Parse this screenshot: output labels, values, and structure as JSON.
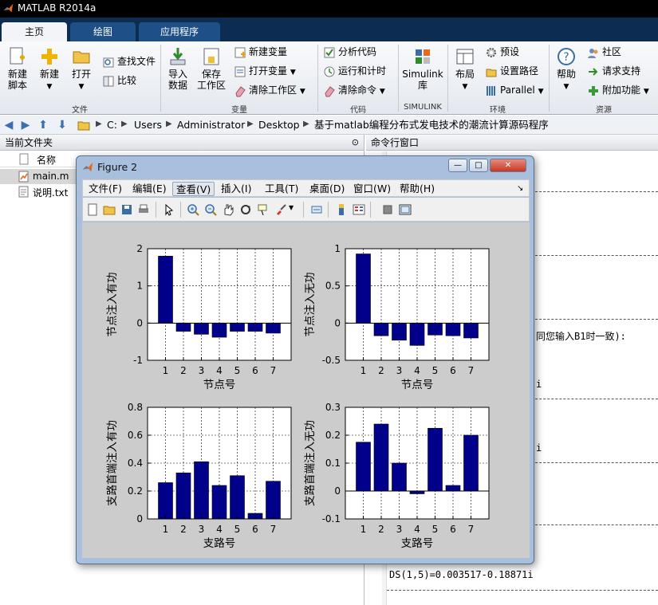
{
  "app": {
    "title": "MATLAB R2014a"
  },
  "tabs": [
    {
      "label": "主页"
    },
    {
      "label": "绘图"
    },
    {
      "label": "应用程序"
    }
  ],
  "ribbon": {
    "file": {
      "group_label": "文件",
      "new_script": "新建\n脚本",
      "new": "新建",
      "open": "打开",
      "find_files": "查找文件",
      "compare": "比较"
    },
    "variable": {
      "group_label": "变量",
      "import": "导入\n数据",
      "save_ws": "保存\n工作区",
      "new_var": "新建变量",
      "open_var": "打开变量",
      "clear_ws": "清除工作区"
    },
    "code": {
      "group_label": "代码",
      "analyze": "分析代码",
      "run_time": "运行和计时",
      "clear_cmd": "清除命令"
    },
    "simulink": {
      "group_label": "SIMULINK",
      "btn": "Simulink\n库"
    },
    "env": {
      "group_label": "环境",
      "layout": "布局",
      "prefs": "预设",
      "set_path": "设置路径",
      "parallel": "Parallel"
    },
    "resources": {
      "group_label": "资源",
      "help": "帮助",
      "community": "社区",
      "support": "请求支持",
      "addons": "附加功能"
    }
  },
  "address": {
    "crumbs": [
      "C:",
      "Users",
      "Administrator",
      "Desktop",
      "基于matlab编程分布式发电技术的潮流计算源码程序"
    ]
  },
  "current_folder": {
    "title": "当前文件夹",
    "column": "名称",
    "files": [
      {
        "name": "main.m"
      },
      {
        "name": "说明.txt"
      }
    ]
  },
  "command_window": {
    "title": "命令行窗口",
    "fragment_1": "同您输入B1时一致):",
    "fragment_2": "i",
    "fragment_3": "i",
    "line_ds": "DS(1,5)=0.003517-0.18871i"
  },
  "figure": {
    "title": "Figure 2",
    "menu": [
      "文件(F)",
      "编辑(E)",
      "查看(V)",
      "插入(I)",
      "工具(T)",
      "桌面(D)",
      "窗口(W)",
      "帮助(H)"
    ],
    "toolbar_icons": [
      "new-figure-icon",
      "open-file-icon",
      "save-icon",
      "print-icon",
      "pointer-icon",
      "zoom-in-icon",
      "zoom-out-icon",
      "pan-icon",
      "rotate-icon",
      "data-cursor-icon",
      "brush-icon",
      "link-icon",
      "colorbar-icon",
      "legend-icon",
      "hide-plot-tools-icon",
      "show-plot-tools-icon"
    ],
    "bar_color": "#00008b"
  },
  "chart_data": [
    {
      "type": "bar",
      "categories": [
        "1",
        "2",
        "3",
        "4",
        "5",
        "6",
        "7"
      ],
      "values": [
        1.8,
        -0.22,
        -0.3,
        -0.38,
        -0.22,
        -0.22,
        -0.27
      ],
      "ylim": [
        -1,
        2
      ],
      "yticks": [
        "-1",
        "0",
        "1",
        "2"
      ],
      "xlabel": "节点号",
      "ylabel": "节点注入有功",
      "grid": true
    },
    {
      "type": "bar",
      "categories": [
        "1",
        "2",
        "3",
        "4",
        "5",
        "6",
        "7"
      ],
      "values": [
        0.93,
        -0.17,
        -0.23,
        -0.3,
        -0.16,
        -0.17,
        -0.2
      ],
      "ylim": [
        -0.5,
        1
      ],
      "yticks": [
        "-0.5",
        "0",
        "0.5",
        "1"
      ],
      "xlabel": "节点号",
      "ylabel": "节点注入无功",
      "grid": true
    },
    {
      "type": "bar",
      "categories": [
        "1",
        "2",
        "3",
        "4",
        "5",
        "6",
        "7"
      ],
      "values": [
        0.26,
        0.33,
        0.41,
        0.24,
        0.31,
        0.04,
        0.27
      ],
      "ylim": [
        0,
        0.8
      ],
      "yticks": [
        "0",
        "0.2",
        "0.4",
        "0.6",
        "0.8"
      ],
      "xlabel": "支路号",
      "ylabel": "支路首端注入有功",
      "grid": true
    },
    {
      "type": "bar",
      "categories": [
        "1",
        "2",
        "3",
        "4",
        "5",
        "6",
        "7"
      ],
      "values": [
        0.175,
        0.24,
        0.1,
        -0.01,
        0.225,
        0.02,
        0.2
      ],
      "ylim": [
        -0.1,
        0.3
      ],
      "yticks": [
        "-0.1",
        "0",
        "0.1",
        "0.2",
        "0.3"
      ],
      "xlabel": "支路号",
      "ylabel": "支路首端注入无功",
      "grid": true
    }
  ]
}
